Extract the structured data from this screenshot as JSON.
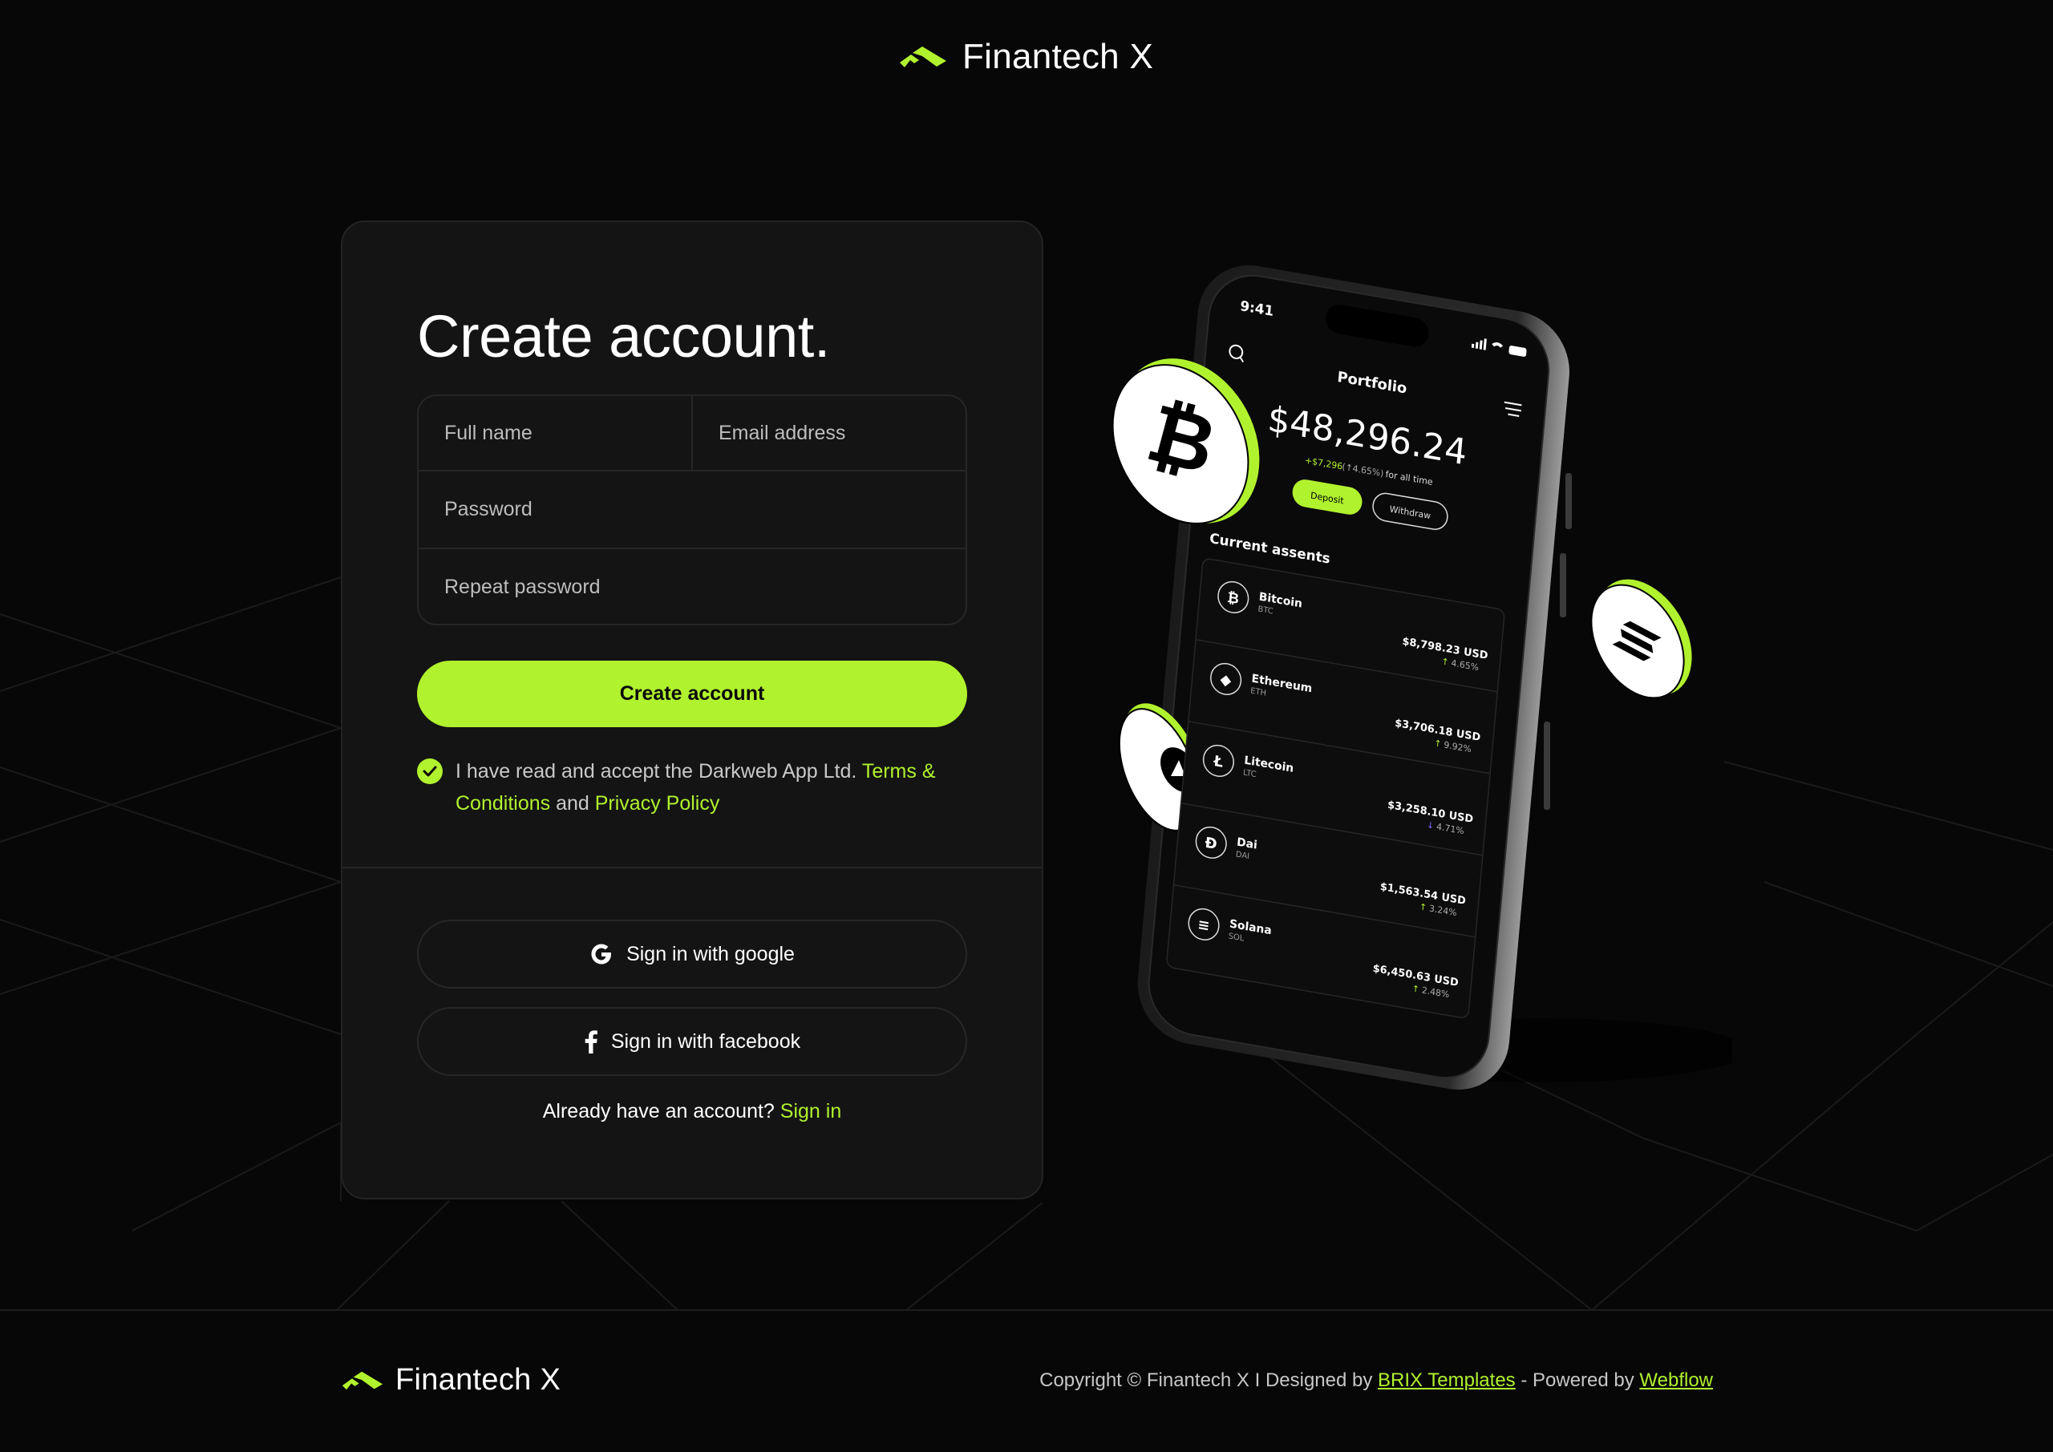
{
  "brand": {
    "name": "Finantech X",
    "accent": "#b1f22e",
    "logo_icon": "chevron-stack-icon"
  },
  "form": {
    "title": "Create account.",
    "fields": {
      "full_name": {
        "placeholder": "Full name",
        "value": ""
      },
      "email": {
        "placeholder": "Email address",
        "value": ""
      },
      "password": {
        "placeholder": "Password",
        "value": ""
      },
      "repeat_password": {
        "placeholder": "Repeat password",
        "value": ""
      }
    },
    "submit_label": "Create account",
    "terms": {
      "checked": true,
      "prefix": "I have read and accept the Darkweb App Ltd. ",
      "terms_link": "Terms & Conditions",
      "middle": " and ",
      "privacy_link": "Privacy Policy"
    },
    "social": {
      "google_label": "Sign in with google",
      "facebook_label": "Sign in with facebook"
    },
    "signin": {
      "prompt": "Already have an account? ",
      "link": "Sign in"
    }
  },
  "phone": {
    "status_time": "9:41",
    "screen_title": "Portfolio",
    "balance": "$48,296.24",
    "change_amount": "+$7,296",
    "change_percent": "(↑4.65%)",
    "change_suffix": "for all time",
    "deposit_label": "Deposit",
    "withdraw_label": "Withdraw",
    "assets_heading": "Current assents",
    "assets": [
      {
        "name": "Bitcoin",
        "ticker": "BTC",
        "value": "$8,798.23 USD",
        "change": "4.65%",
        "direction": "up",
        "icon": "bitcoin-icon",
        "glyph": "₿"
      },
      {
        "name": "Ethereum",
        "ticker": "ETH",
        "value": "$3,706.18 USD",
        "change": "9.92%",
        "direction": "up",
        "icon": "ethereum-icon",
        "glyph": "◆"
      },
      {
        "name": "Litecoin",
        "ticker": "LTC",
        "value": "$3,258.10 USD",
        "change": "4.71%",
        "direction": "down",
        "icon": "litecoin-icon",
        "glyph": "Ł"
      },
      {
        "name": "Dai",
        "ticker": "DAI",
        "value": "$1,563.54 USD",
        "change": "3.24%",
        "direction": "up",
        "icon": "dai-icon",
        "glyph": "Đ"
      },
      {
        "name": "Solana",
        "ticker": "SOL",
        "value": "$6,450.63 USD",
        "change": "2.48%",
        "direction": "up",
        "icon": "solana-icon",
        "glyph": "≡"
      }
    ],
    "up_color": "#b1f22e",
    "down_color": "#7b6cff"
  },
  "footer": {
    "copyright_prefix": "Copyright © Finantech X I Designed by ",
    "designer_link": "BRIX Templates",
    "powered_prefix": " - Powered by ",
    "powered_link": "Webflow"
  }
}
